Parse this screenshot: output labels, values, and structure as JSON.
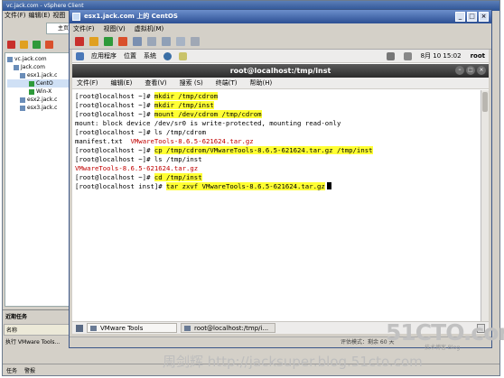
{
  "vsphere": {
    "title": "vc.jack.com - vSphere Client",
    "menu": [
      "文件(F)",
      "编辑(E)",
      "视图"
    ],
    "home_tab": "主页",
    "tree": [
      "vc.jack.com",
      "Jack.com",
      "esx1.jack.c",
      "CentO",
      "Win-X",
      "esx2.jack.c",
      "esx3.jack.c"
    ],
    "recent_tasks_title": "近期任务",
    "recent_col_name": "名称",
    "recent_row": "执行 VMware Tools...",
    "status_tasks": "任务",
    "status_alarms": "警报"
  },
  "console": {
    "title": "esx1.jack.com 上的 CentOS",
    "menu": [
      "文件(F)",
      "视图(V)",
      "虚拟机(M)"
    ],
    "status_text": "评估模式：剩余 60 天"
  },
  "gnome": {
    "top_menu": [
      "应用程序",
      "位置",
      "系统"
    ],
    "clock": "8月 10 15:02",
    "user": "root",
    "taskbar": [
      "VMware Tools",
      "root@localhost:/tmp/i..."
    ]
  },
  "terminal": {
    "title": "root@localhost:/tmp/inst",
    "menu": [
      "文件(F)",
      "编辑(E)",
      "查看(V)",
      "搜索 (S)",
      "终端(T)",
      "帮助(H)"
    ],
    "lines": [
      {
        "prompt": "[root@localhost ~]# ",
        "cmd": "mkdir /tmp/cdrom",
        "hl": true,
        "red": false
      },
      {
        "prompt": "[root@localhost ~]# ",
        "cmd": "mkdir /tmp/inst",
        "hl": true,
        "red": false
      },
      {
        "prompt": "[root@localhost ~]# ",
        "cmd": "mount /dev/cdrom /tmp/cdrom",
        "hl": true,
        "red": false
      },
      {
        "prompt": "",
        "cmd": "mount: block device /dev/sr0 is write-protected, mounting read-only",
        "hl": false,
        "red": false
      },
      {
        "prompt": "[root@localhost ~]# ",
        "cmd": "ls /tmp/cdrom",
        "hl": false,
        "red": false
      },
      {
        "prompt": "manifest.txt  ",
        "cmd": "VMwareTools-8.6.5-621624.tar.gz",
        "hl": false,
        "red": true
      },
      {
        "prompt": "[root@localhost ~]# ",
        "cmd": "cp /tmp/cdrom/VMwareTools-8.6.5-621624.tar.gz /tmp/inst",
        "hl": true,
        "red": false
      },
      {
        "prompt": "[root@localhost ~]# ",
        "cmd": "ls /tmp/inst",
        "hl": false,
        "red": false
      },
      {
        "prompt": "",
        "cmd": "VMwareTools-8.6.5-621624.tar.gz",
        "hl": false,
        "red": true
      },
      {
        "prompt": "[root@localhost ~]# ",
        "cmd": "cd /tmp/inst",
        "hl": true,
        "red": false
      },
      {
        "prompt": "[root@localhost inst]# ",
        "cmd": "tar zxvf VMwareTools-8.6.5-621624.tar.gz",
        "hl": true,
        "red": false,
        "cursor": true
      }
    ]
  },
  "watermark": {
    "logo": "51CTO.com",
    "logo_sub": "技术博客 Blog",
    "blog": "周剑辉 http://jacksuper.blog.51cto.com"
  },
  "colors": {
    "highlight": "#ffff33",
    "file_red": "#c00000",
    "titlebar_blue": "#2c4f93"
  }
}
